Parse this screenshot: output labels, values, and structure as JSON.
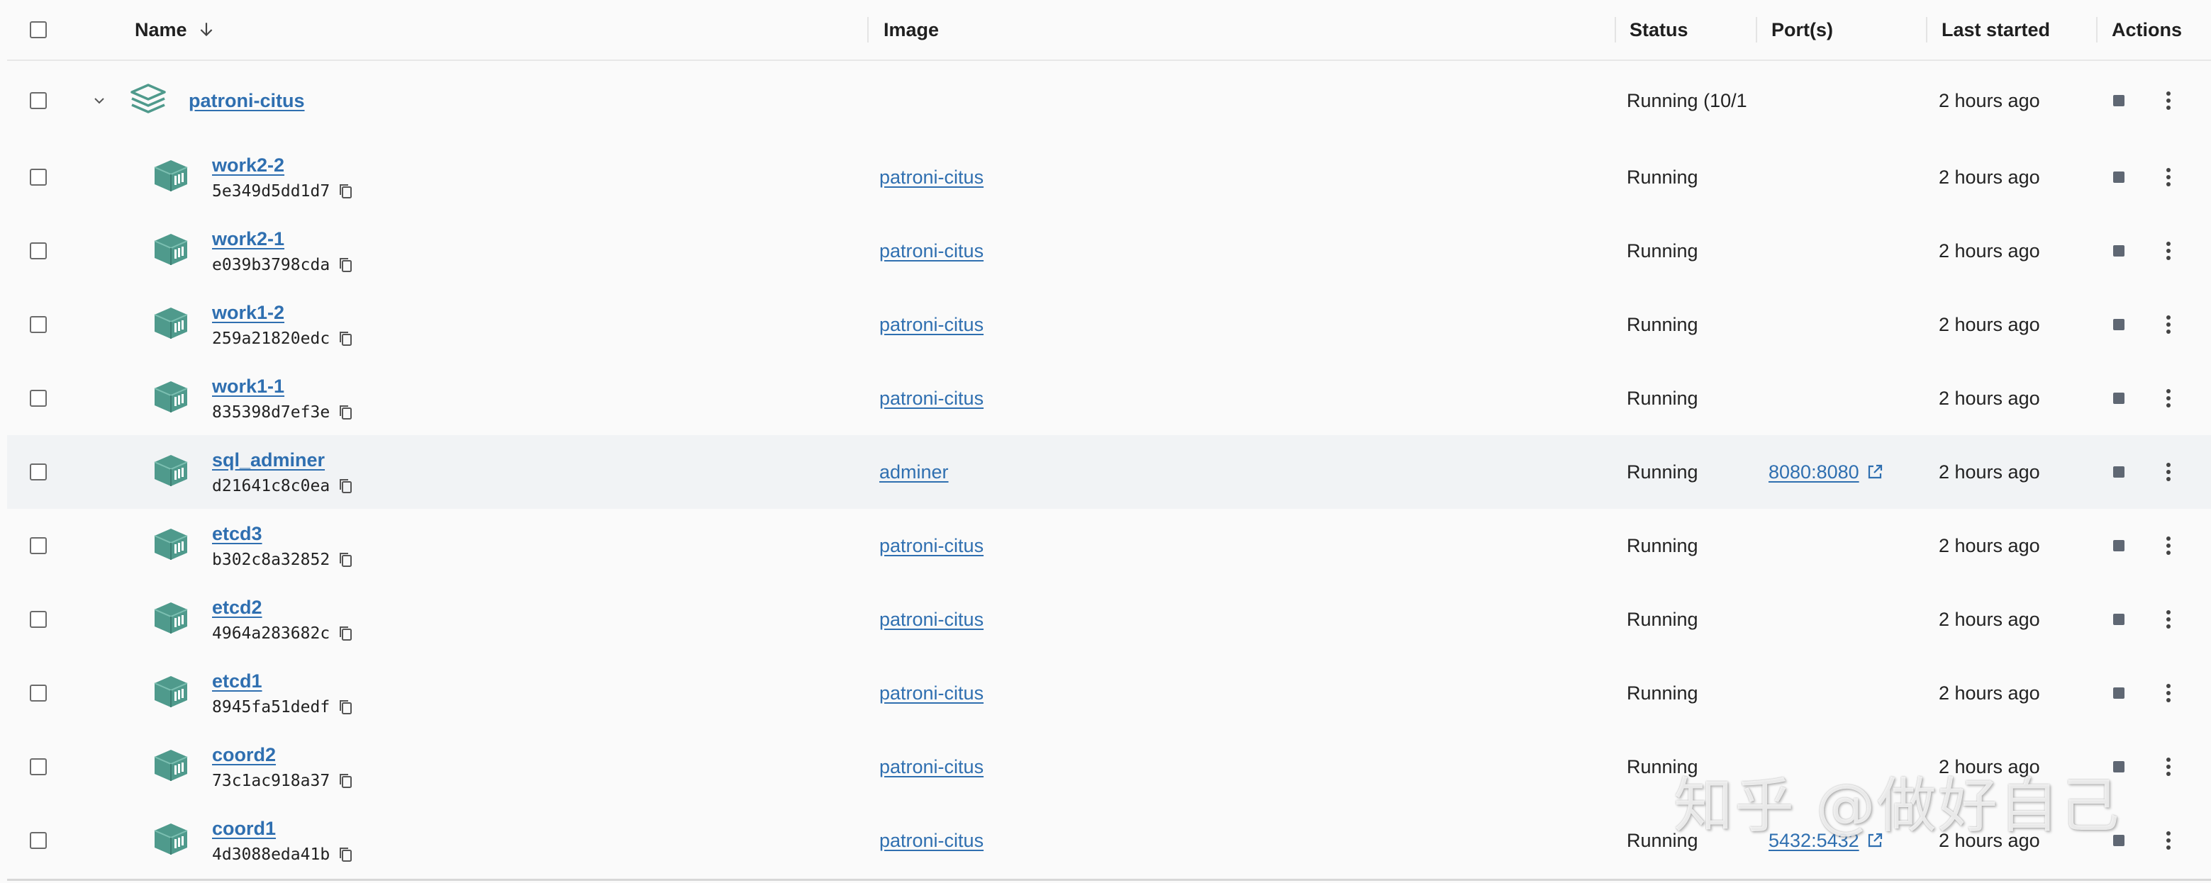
{
  "header": {
    "name": "Name",
    "image": "Image",
    "status": "Status",
    "ports": "Port(s)",
    "last_started": "Last started",
    "actions": "Actions"
  },
  "group": {
    "name": "patroni-citus",
    "status": "Running (10/1",
    "last_started": "2 hours ago"
  },
  "containers": [
    {
      "name": "work2-2",
      "id": "5e349d5dd1d7",
      "image": "patroni-citus",
      "status": "Running",
      "port": "",
      "last_started": "2 hours ago"
    },
    {
      "name": "work2-1",
      "id": "e039b3798cda",
      "image": "patroni-citus",
      "status": "Running",
      "port": "",
      "last_started": "2 hours ago"
    },
    {
      "name": "work1-2",
      "id": "259a21820edc",
      "image": "patroni-citus",
      "status": "Running",
      "port": "",
      "last_started": "2 hours ago"
    },
    {
      "name": "work1-1",
      "id": "835398d7ef3e",
      "image": "patroni-citus",
      "status": "Running",
      "port": "",
      "last_started": "2 hours ago"
    },
    {
      "name": "sql_adminer",
      "id": "d21641c8c0ea",
      "image": "adminer",
      "status": "Running",
      "port": "8080:8080",
      "last_started": "2 hours ago"
    },
    {
      "name": "etcd3",
      "id": "b302c8a32852",
      "image": "patroni-citus",
      "status": "Running",
      "port": "",
      "last_started": "2 hours ago"
    },
    {
      "name": "etcd2",
      "id": "4964a283682c",
      "image": "patroni-citus",
      "status": "Running",
      "port": "",
      "last_started": "2 hours ago"
    },
    {
      "name": "etcd1",
      "id": "8945fa51dedf",
      "image": "patroni-citus",
      "status": "Running",
      "port": "",
      "last_started": "2 hours ago"
    },
    {
      "name": "coord2",
      "id": "73c1ac918a37",
      "image": "patroni-citus",
      "status": "Running",
      "port": "",
      "last_started": "2 hours ago"
    },
    {
      "name": "coord1",
      "id": "4d3088eda41b",
      "image": "patroni-citus",
      "status": "Running",
      "port": "5432:5432",
      "last_started": "2 hours ago"
    }
  ],
  "watermark": "知乎 @做好自己",
  "colors": {
    "link": "#2f6fb0",
    "container_icon": "#4f9a8c",
    "stack_icon": "#4f9a8c",
    "row_highlight": "#f1f3f5",
    "stop_icon": "#5f6773"
  }
}
